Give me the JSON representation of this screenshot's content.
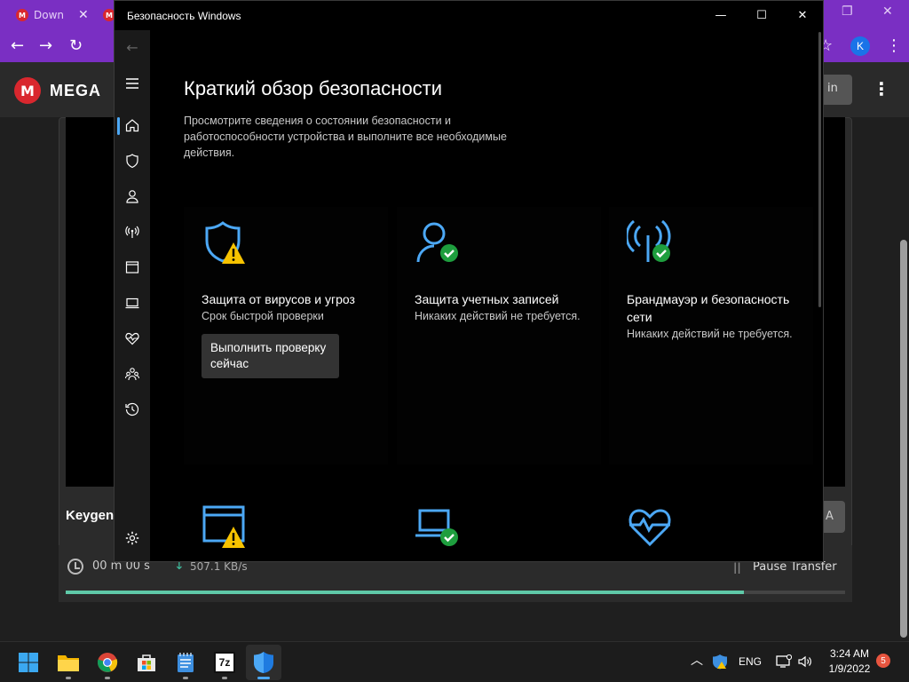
{
  "browser": {
    "tabs": [
      {
        "label": "Down",
        "active": true
      },
      {
        "label": "",
        "active": false
      }
    ],
    "tab_close": "✕",
    "window_controls": {
      "restore": "❐",
      "close": "✕"
    },
    "nav": {
      "back": "←",
      "forward": "→",
      "reload": "↻",
      "star": "☆",
      "menu": "⋮"
    },
    "profile_initial": "K",
    "accent_color": "#7a2fc3"
  },
  "mega": {
    "logo_letter": "M",
    "logo_text": "MEGA",
    "login_label": "in",
    "file_name": "Keygen.",
    "download_label": "A",
    "time_left": "00 m  00 s",
    "speed": "507.1 KB/s",
    "pause_label": "Pause Transfer",
    "progress_fraction": 0.87
  },
  "security": {
    "window_title": "Безопасность Windows",
    "window_controls": {
      "minimize": "—",
      "maximize": "☐",
      "close": "✕"
    },
    "back_icon": "←",
    "page_title": "Краткий обзор безопасности",
    "page_description": "Просмотрите сведения о состоянии безопасности и работоспособности устройства и выполните все необходимые действия.",
    "cards": [
      {
        "title": "Защита от вирусов и угроз",
        "subtitle": "Срок быстрой проверки",
        "status": "warning",
        "icon": "shield-icon",
        "button": "Выполнить проверку сейчас"
      },
      {
        "title": "Защита учетных записей",
        "subtitle": "Никаких действий не требуется.",
        "status": "ok",
        "icon": "person-icon"
      },
      {
        "title": "Брандмауэр и безопасность сети",
        "subtitle": "Никаких действий не требуется.",
        "status": "ok",
        "icon": "antenna-icon"
      }
    ],
    "cards_row2": [
      {
        "icon": "app-browser-icon",
        "status": "warning"
      },
      {
        "icon": "laptop-icon",
        "status": "ok"
      },
      {
        "icon": "heart-pulse-icon",
        "status": "none"
      }
    ],
    "nav_items": [
      "hamburger-icon",
      "home-icon",
      "shield-icon",
      "person-icon",
      "antenna-icon",
      "app-browser-icon",
      "laptop-icon",
      "heart-pulse-icon",
      "family-icon",
      "history-icon",
      "settings-icon"
    ],
    "colors": {
      "accent": "#4ca8f5",
      "warning": "#f7c300",
      "ok": "#1e9e3e"
    }
  },
  "taskbar": {
    "apps": [
      "start-icon",
      "file-explorer-icon",
      "chrome-icon",
      "store-icon",
      "notepad-icon",
      "7zip-icon",
      "windows-security-icon"
    ],
    "zip_label": "7z",
    "tray_chevron": "︿",
    "language": "ENG",
    "time": "3:24 AM",
    "date": "1/9/2022",
    "notifications": "5"
  }
}
